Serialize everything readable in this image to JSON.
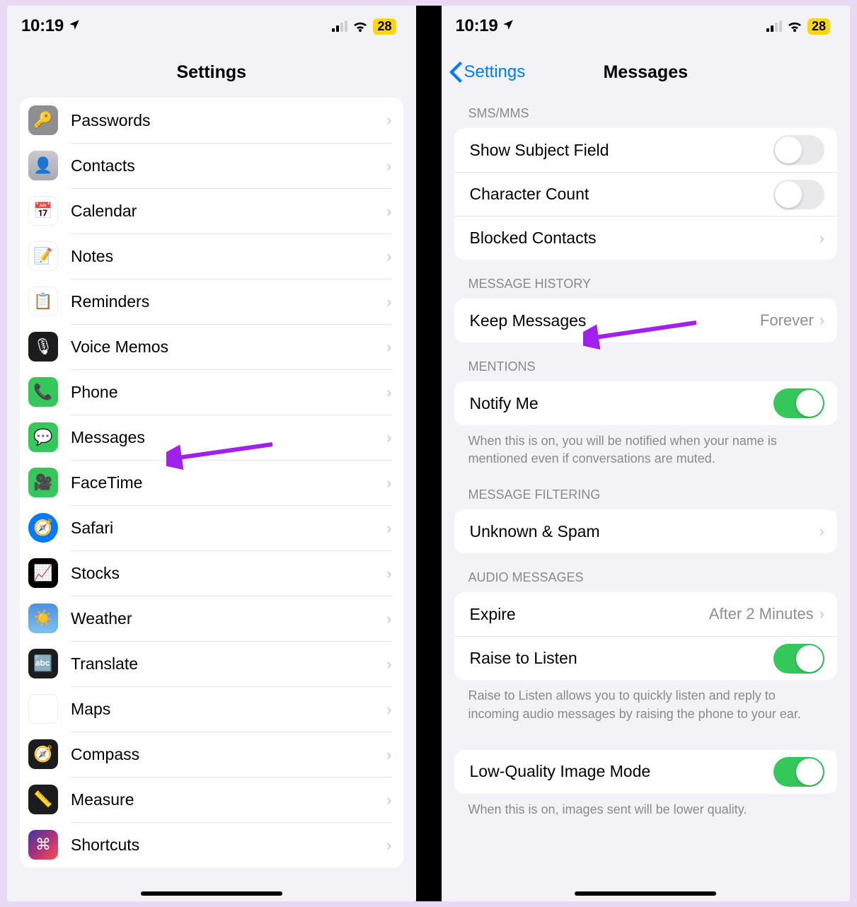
{
  "status": {
    "time": "10:19",
    "battery": "28"
  },
  "left": {
    "title": "Settings",
    "items": [
      {
        "id": "passwords",
        "label": "Passwords",
        "icon": "ic-pw",
        "glyph": "🔑"
      },
      {
        "id": "contacts",
        "label": "Contacts",
        "icon": "ic-ct",
        "glyph": "👤"
      },
      {
        "id": "calendar",
        "label": "Calendar",
        "icon": "ic-cal",
        "glyph": "📅"
      },
      {
        "id": "notes",
        "label": "Notes",
        "icon": "ic-no",
        "glyph": "📝"
      },
      {
        "id": "reminders",
        "label": "Reminders",
        "icon": "ic-rm",
        "glyph": "📋"
      },
      {
        "id": "voice-memos",
        "label": "Voice Memos",
        "icon": "ic-vm",
        "glyph": "🎙"
      },
      {
        "id": "phone",
        "label": "Phone",
        "icon": "ic-ph",
        "glyph": "📞"
      },
      {
        "id": "messages",
        "label": "Messages",
        "icon": "ic-msg",
        "glyph": "💬"
      },
      {
        "id": "facetime",
        "label": "FaceTime",
        "icon": "ic-ft",
        "glyph": "🎥"
      },
      {
        "id": "safari",
        "label": "Safari",
        "icon": "ic-sf",
        "glyph": "🧭",
        "wrap": true
      },
      {
        "id": "stocks",
        "label": "Stocks",
        "icon": "ic-st",
        "glyph": "📈"
      },
      {
        "id": "weather",
        "label": "Weather",
        "icon": "ic-we",
        "glyph": "☀️"
      },
      {
        "id": "translate",
        "label": "Translate",
        "icon": "ic-tr",
        "glyph": "🔤"
      },
      {
        "id": "maps",
        "label": "Maps",
        "icon": "ic-mp",
        "glyph": "🗺"
      },
      {
        "id": "compass",
        "label": "Compass",
        "icon": "ic-cp",
        "glyph": "🧭"
      },
      {
        "id": "measure",
        "label": "Measure",
        "icon": "ic-me",
        "glyph": "📏"
      },
      {
        "id": "shortcuts",
        "label": "Shortcuts",
        "icon": "ic-sc",
        "glyph": "⌘"
      }
    ]
  },
  "right": {
    "back": "Settings",
    "title": "Messages",
    "sections": [
      {
        "header": "SMS/MMS",
        "rows": [
          {
            "id": "show-subject",
            "label": "Show Subject Field",
            "type": "toggle",
            "on": false
          },
          {
            "id": "char-count",
            "label": "Character Count",
            "type": "toggle",
            "on": false
          },
          {
            "id": "blocked",
            "label": "Blocked Contacts",
            "type": "nav"
          }
        ]
      },
      {
        "header": "MESSAGE HISTORY",
        "rows": [
          {
            "id": "keep",
            "label": "Keep Messages",
            "type": "nav",
            "value": "Forever"
          }
        ]
      },
      {
        "header": "MENTIONS",
        "rows": [
          {
            "id": "notify",
            "label": "Notify Me",
            "type": "toggle",
            "on": true
          }
        ],
        "footer": "When this is on, you will be notified when your name is mentioned even if conversations are muted."
      },
      {
        "header": "MESSAGE FILTERING",
        "rows": [
          {
            "id": "unknown",
            "label": "Unknown & Spam",
            "type": "nav"
          }
        ]
      },
      {
        "header": "AUDIO MESSAGES",
        "rows": [
          {
            "id": "expire",
            "label": "Expire",
            "type": "nav",
            "value": "After 2 Minutes"
          },
          {
            "id": "raise",
            "label": "Raise to Listen",
            "type": "toggle",
            "on": true
          }
        ],
        "footer": "Raise to Listen allows you to quickly listen and reply to incoming audio messages by raising the phone to your ear."
      },
      {
        "header": "",
        "rows": [
          {
            "id": "lowq",
            "label": "Low-Quality Image Mode",
            "type": "toggle",
            "on": true
          }
        ],
        "footer": "When this is on, images sent will be lower quality."
      }
    ]
  }
}
